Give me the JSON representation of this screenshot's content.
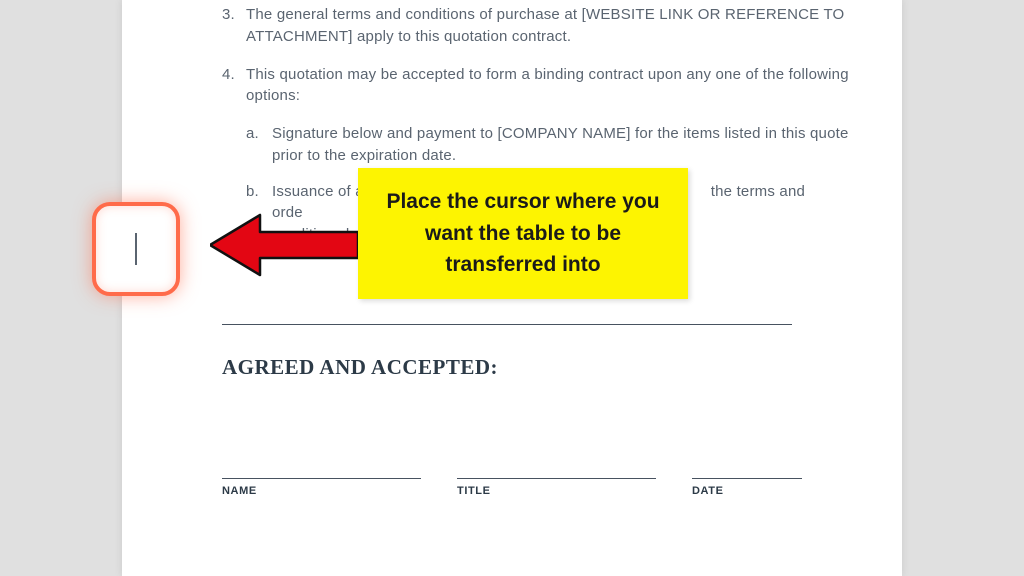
{
  "list": {
    "item3": {
      "num": "3.",
      "text": "The general terms and conditions of purchase at [WEBSITE LINK OR REFERENCE TO ATTACHMENT] apply to this quotation contract."
    },
    "item4": {
      "num": "4.",
      "text": "This quotation may be accepted to form a binding contract upon any one of the following options:"
    },
    "sub_a": {
      "num": "a.",
      "text": "Signature below and payment to [COMPANY NAME] for the items listed in this quote prior to the expiration date."
    },
    "sub_b": {
      "num": "b.",
      "text_left": "Issuance of a purchase orde",
      "text_right": "the terms and conditions herein prior t"
    }
  },
  "callout": "Place the cursor where you want the table to be transferred into",
  "agreed_heading": "AGREED AND ACCEPTED:",
  "sig": {
    "name": "NAME",
    "title": "TITLE",
    "date": "DATE"
  }
}
